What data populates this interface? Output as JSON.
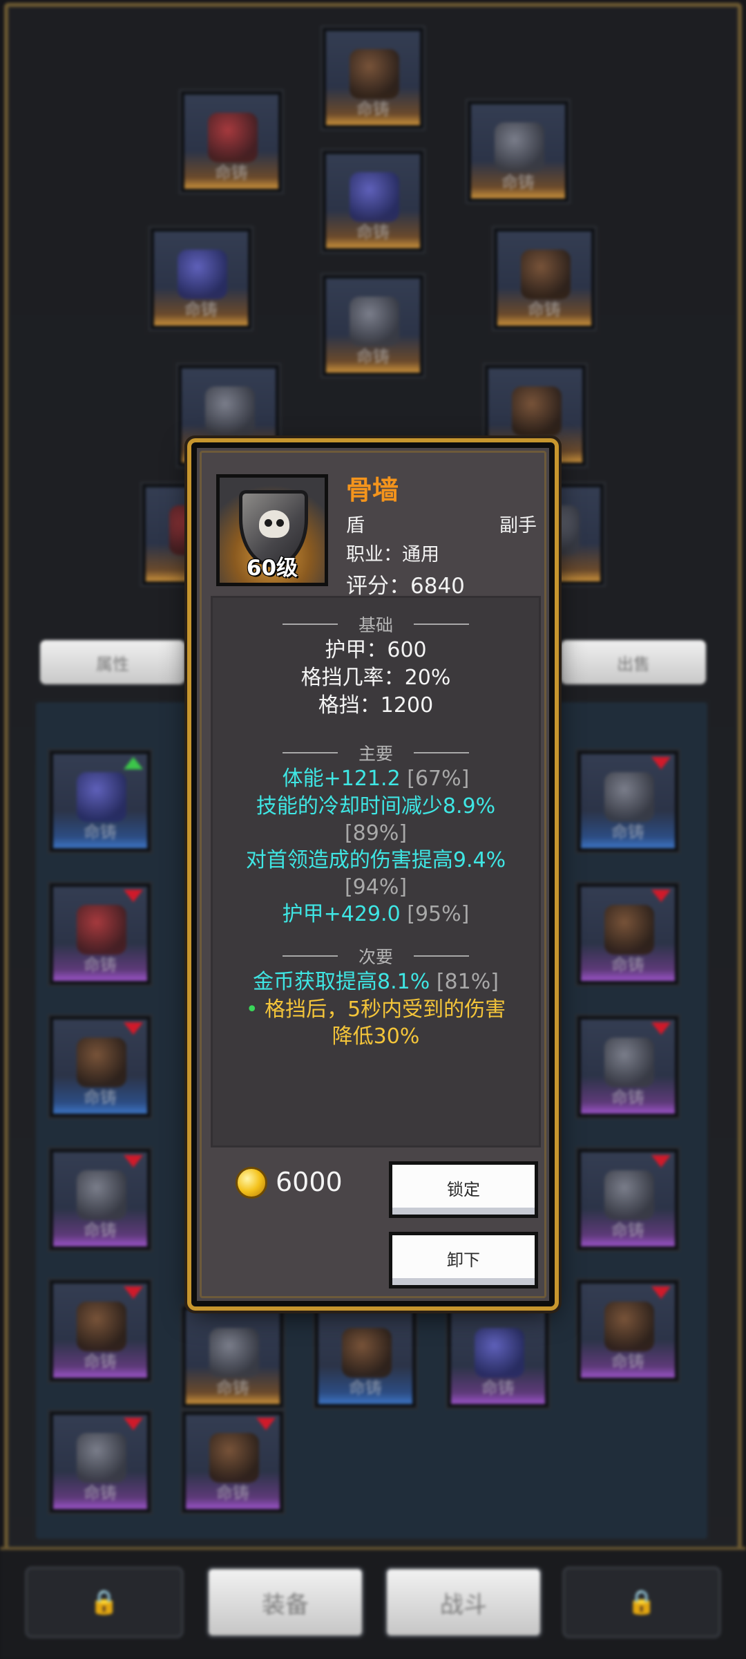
{
  "background": {
    "left_button_label": "属性",
    "right_button_label": "出售",
    "equip_slot_label": "命铸",
    "tabs": [
      {
        "label": "",
        "icon": "lock-icon"
      },
      {
        "label": "装备"
      },
      {
        "label": "战斗"
      },
      {
        "label": "",
        "icon": "lock-icon"
      }
    ]
  },
  "item": {
    "name": "骨墙",
    "level_label": "60级",
    "type": "盾",
    "slot": "副手",
    "class_line": "职业：通用",
    "score_line": "评分：6840",
    "icon": "skull-shield-icon"
  },
  "sections": {
    "base": {
      "header": "基础",
      "lines": [
        "护甲：600",
        "格挡几率：20%",
        "格挡：1200"
      ]
    },
    "primary": {
      "header": "主要",
      "line1_text": "体能+121.2",
      "line1_pct": "[67%]",
      "line2_text": "技能的冷却时间减少8.9%",
      "line2_pct": "[89%]",
      "line3_text": "对首领造成的伤害提高9.4%",
      "line3_pct": "[94%]",
      "line4_text": "护甲+429.0",
      "line4_pct": "[95%]"
    },
    "secondary": {
      "header": "次要",
      "line1_text": "金币获取提高8.1%",
      "line1_pct": "[81%]",
      "legendary_bullet": "•",
      "legendary_line1": "格挡后，5秒内受到的伤害",
      "legendary_line2": "降低30%"
    }
  },
  "gold": {
    "amount": "6000",
    "icon": "gold-coin-icon"
  },
  "buttons": {
    "lock": "锁定",
    "unequip": "卸下"
  },
  "colors": {
    "name": "#f4941c",
    "affix": "#3fe6e4",
    "legendary": "#f4c53a",
    "frame_gold": "#c7962e"
  }
}
